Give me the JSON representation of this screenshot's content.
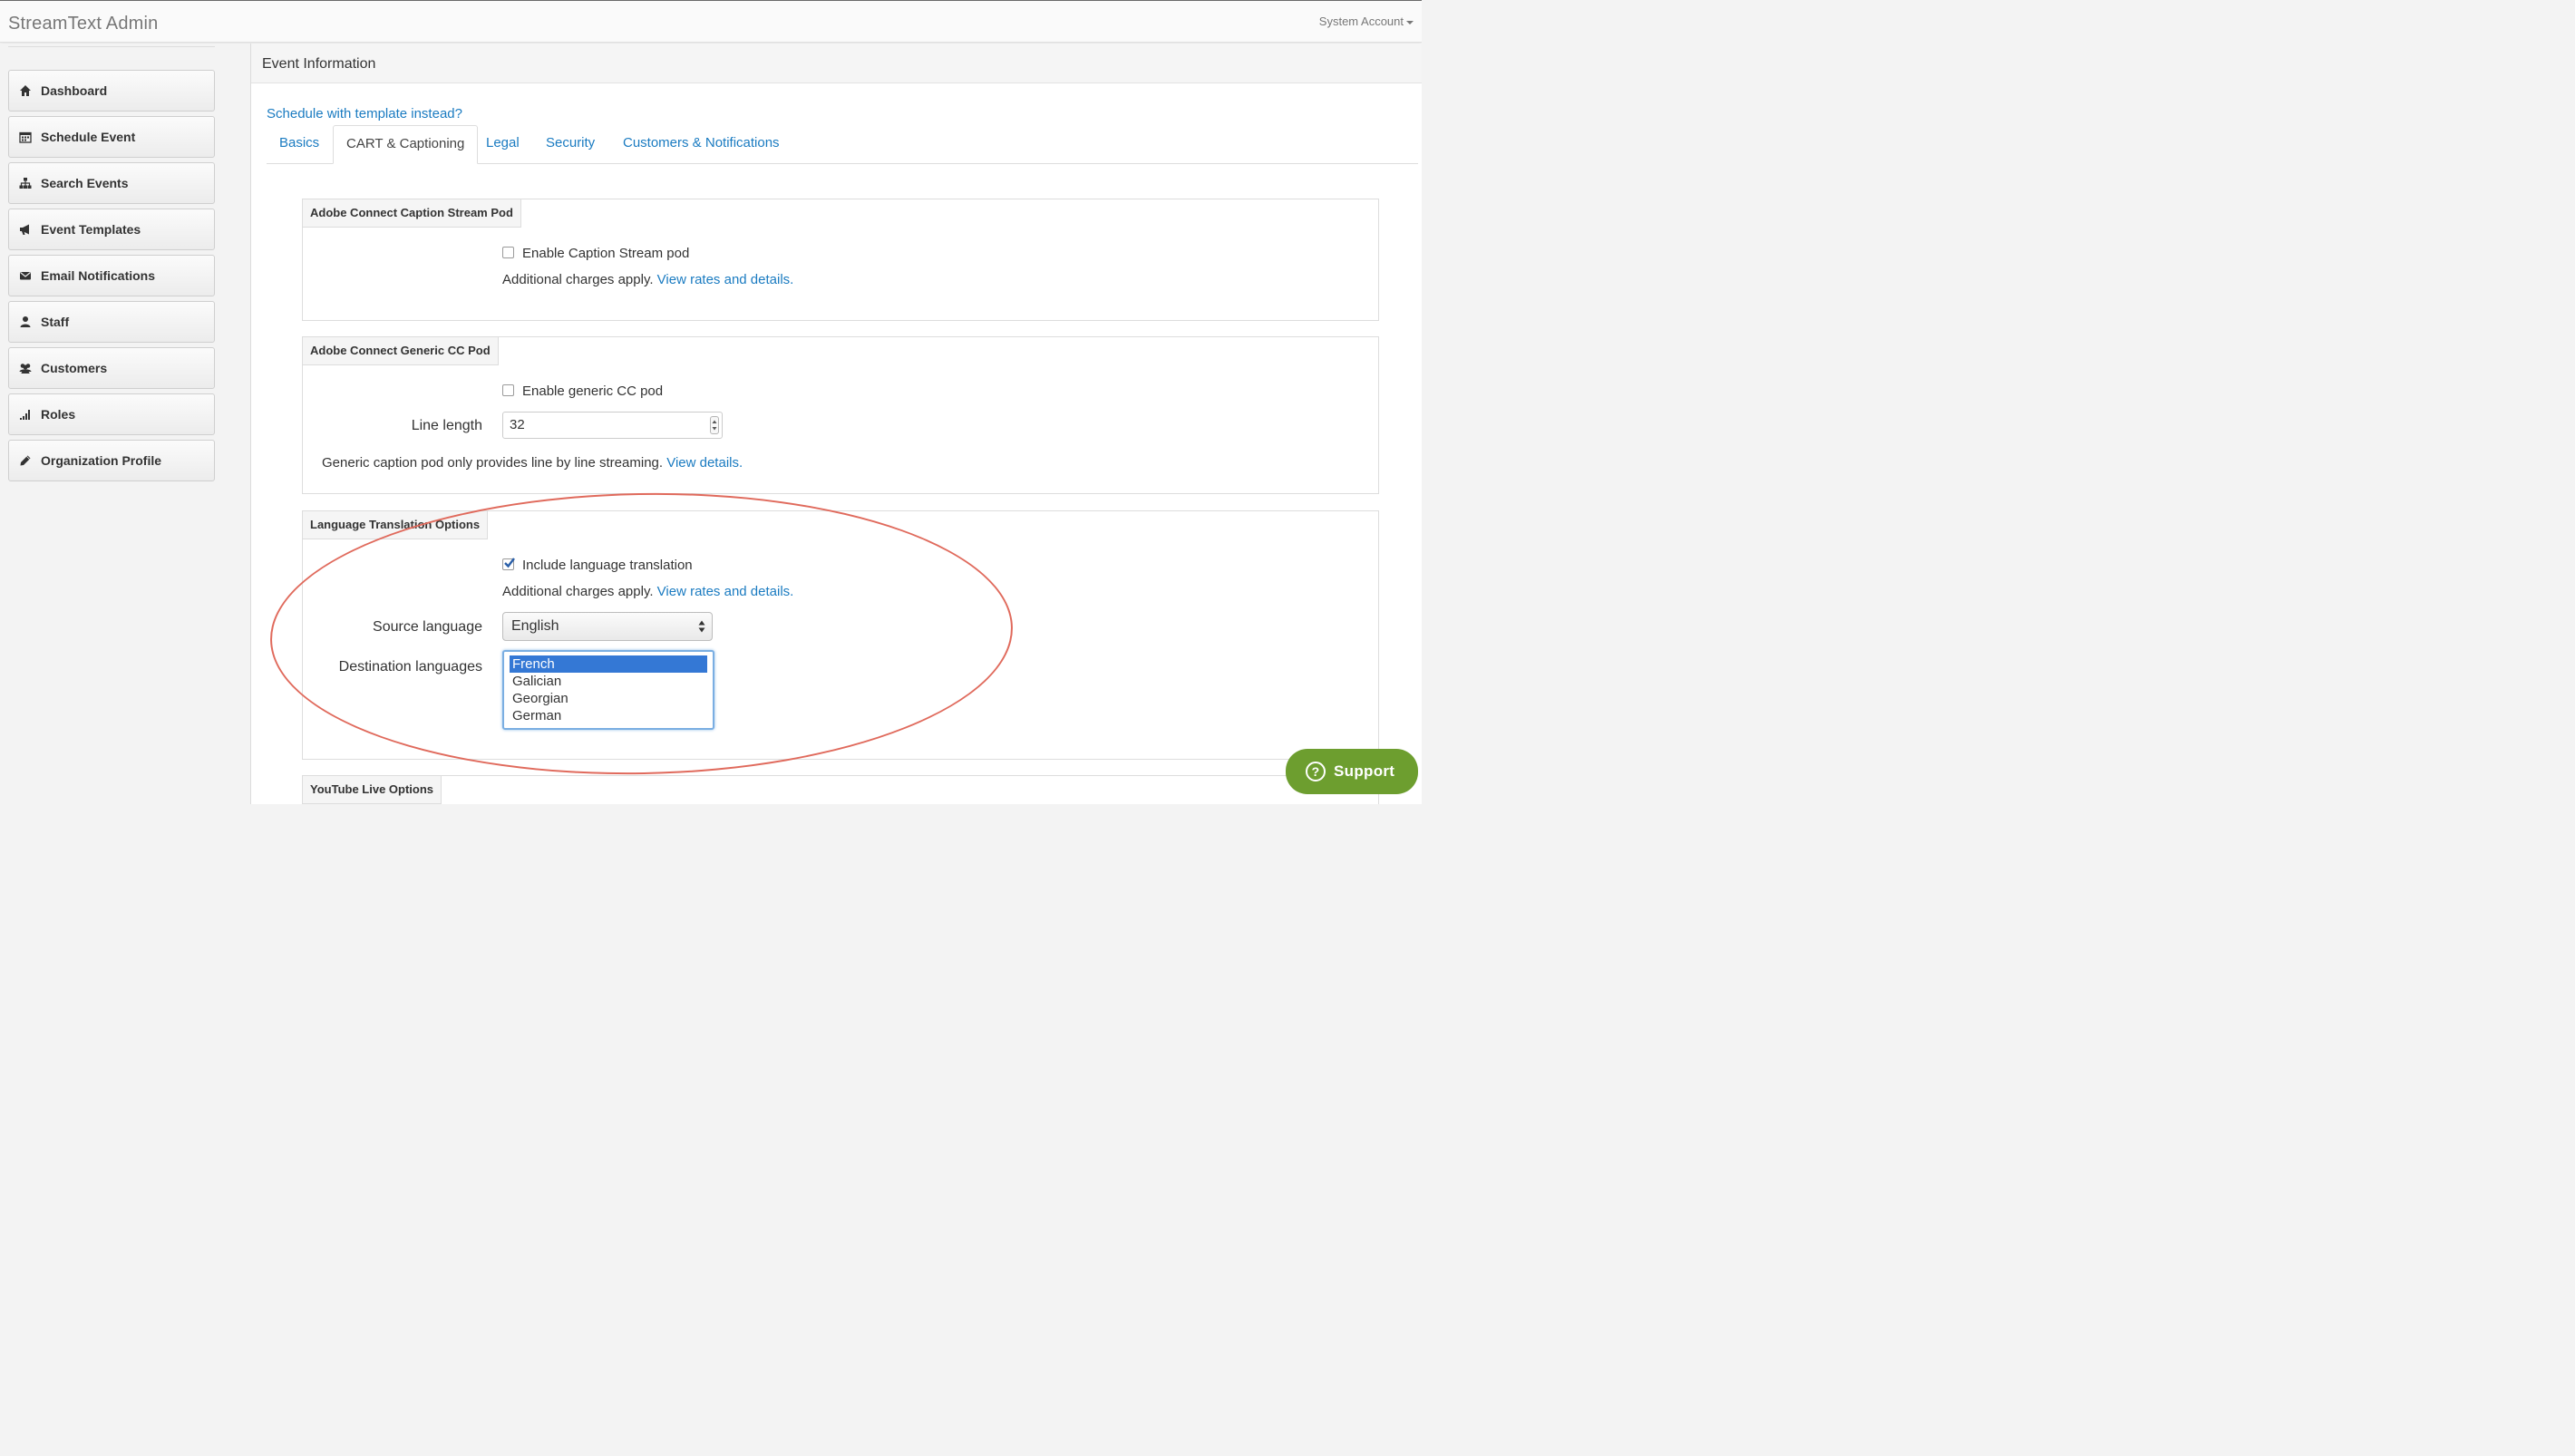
{
  "app": {
    "brand": "StreamText Admin",
    "account": "System Account"
  },
  "sidebar": {
    "items": [
      {
        "label": "Dashboard",
        "icon": "home-icon"
      },
      {
        "label": "Schedule Event",
        "icon": "calendar-icon"
      },
      {
        "label": "Search Events",
        "icon": "sitemap-icon"
      },
      {
        "label": "Event Templates",
        "icon": "bullhorn-icon"
      },
      {
        "label": "Email Notifications",
        "icon": "envelope-icon"
      },
      {
        "label": "Staff",
        "icon": "user-icon"
      },
      {
        "label": "Customers",
        "icon": "users-icon"
      },
      {
        "label": "Roles",
        "icon": "signal-bars-icon"
      },
      {
        "label": "Organization Profile",
        "icon": "pencil-icon"
      }
    ]
  },
  "main": {
    "title": "Event Information",
    "template_link": "Schedule with template instead?",
    "tabs": [
      {
        "label": "Basics",
        "active": false
      },
      {
        "label": "CART & Captioning",
        "active": true
      },
      {
        "label": "Legal",
        "active": false
      },
      {
        "label": "Security",
        "active": false
      },
      {
        "label": "Customers & Notifications",
        "active": false
      }
    ],
    "panels": {
      "caption_stream": {
        "title": "Adobe Connect Caption Stream Pod",
        "checkbox_label": "Enable Caption Stream pod",
        "checked": false,
        "note": "Additional charges apply.",
        "link": "View rates and details."
      },
      "generic_cc": {
        "title": "Adobe Connect Generic CC Pod",
        "checkbox_label": "Enable generic CC pod",
        "checked": false,
        "line_length_label": "Line length",
        "line_length_value": "32",
        "note": "Generic caption pod only provides line by line streaming.",
        "link": "View details."
      },
      "translation": {
        "title": "Language Translation Options",
        "checkbox_label": "Include language translation",
        "checked": true,
        "note": "Additional charges apply.",
        "link": "View rates and details.",
        "source_label": "Source language",
        "source_value": "English",
        "dest_label": "Destination languages",
        "dest_options": [
          "French",
          "Galician",
          "Georgian",
          "German"
        ],
        "dest_selected": "French"
      },
      "youtube": {
        "title": "YouTube Live Options"
      }
    }
  },
  "support": {
    "label": "Support"
  },
  "colors": {
    "link": "#1a7bc1",
    "annotation": "#e06a5c",
    "support": "#6d9e2f",
    "selected_option": "#3478d5"
  }
}
